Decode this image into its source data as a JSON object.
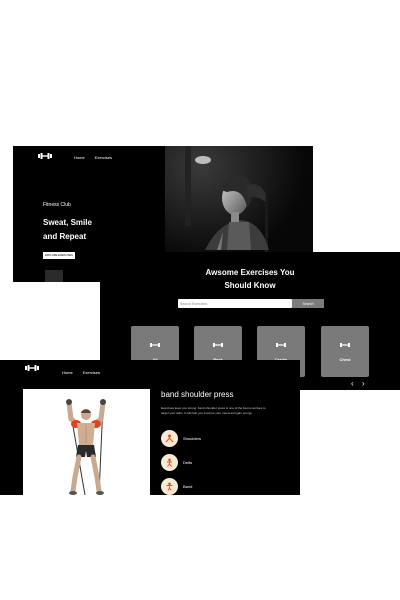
{
  "hero": {
    "nav": [
      "Home",
      "Exercises"
    ],
    "brand": "Fitness Club",
    "headline_line1": "Sweat, Smile",
    "headline_line2": "and Repeat",
    "cta_label": "EXPLORE EXERCISES",
    "logo_icon": "dumbbell-icon",
    "photo": "woman-workout-photo"
  },
  "exercises": {
    "title_line1": "Awsome Exercises You",
    "title_line2": "Should Know",
    "search_placeholder": "Search Exercises",
    "search_button": "Search",
    "categories": [
      "All",
      "Back",
      "Cardio",
      "Chest"
    ],
    "category_icon": "dumbbell-icon",
    "prev_icon": "chevron-left-icon",
    "next_icon": "chevron-right-icon"
  },
  "detail": {
    "nav": [
      "Home",
      "Exercises"
    ],
    "logo_icon": "dumbbell-icon",
    "title": "band shoulder press",
    "description": "Exercises keep you strong. band shoulder press is one of the best exercises to target your delts. It will help you improve your mood and gain energy.",
    "tags": [
      {
        "label": "Shoulders",
        "icon": "body-part-icon"
      },
      {
        "label": "Delts",
        "icon": "target-muscle-icon"
      },
      {
        "label": "Band",
        "icon": "equipment-icon"
      }
    ]
  },
  "colors": {
    "background": "#ffffff",
    "panel": "#000000",
    "card": "#7a7a7a",
    "tag_circle": "#fbe9d6",
    "muscle_highlight": "#e0431f"
  }
}
